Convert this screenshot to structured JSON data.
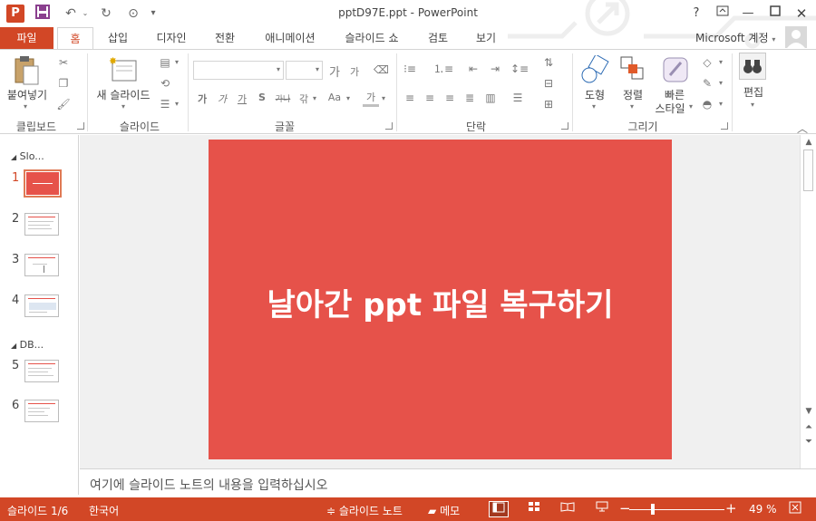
{
  "window": {
    "title": "pptD97E.ppt - PowerPoint",
    "help": "?",
    "app_icon": "P",
    "qat_save_icon": "save-icon",
    "qat_undo_icon": "undo-icon",
    "qat_redo_icon": "redo-icon",
    "qat_preview_icon": "preview-icon"
  },
  "tabs": [
    {
      "label": "파일"
    },
    {
      "label": "홈"
    },
    {
      "label": "삽입"
    },
    {
      "label": "디자인"
    },
    {
      "label": "전환"
    },
    {
      "label": "애니메이션"
    },
    {
      "label": "슬라이드 쇼"
    },
    {
      "label": "검토"
    },
    {
      "label": "보기"
    }
  ],
  "account": {
    "label": "Microsoft 계정"
  },
  "ribbon": {
    "clipboard": {
      "label": "클립보드",
      "paste": "붙여넣기"
    },
    "slides": {
      "label": "슬라이드",
      "new_slide": "새 슬라이드"
    },
    "font": {
      "label": "글꼴",
      "grow": "가",
      "shrink": "가",
      "bold": "가",
      "italic": "가",
      "underline": "가",
      "shadow": "S",
      "strike": "가나",
      "spacing": "갂",
      "case": "Aa",
      "color": "가"
    },
    "paragraph": {
      "label": "단락"
    },
    "drawing": {
      "label": "그리기",
      "shapes": "도형",
      "arrange": "정렬",
      "quick_styles_1": "빠른",
      "quick_styles_2": "스타일"
    },
    "editing": {
      "label": "편집"
    }
  },
  "thumbnails": {
    "sections": [
      "Slo...",
      "DB..."
    ],
    "slides": [
      {
        "num": "1"
      },
      {
        "num": "2"
      },
      {
        "num": "3"
      },
      {
        "num": "4"
      },
      {
        "num": "5"
      },
      {
        "num": "6"
      }
    ]
  },
  "slide": {
    "title": "날아간 ppt 파일 복구하기",
    "bg": "#e6524a"
  },
  "notes": {
    "placeholder": "여기에 슬라이드 노트의 내용을 입력하십시오"
  },
  "status": {
    "slide_counter": "슬라이드 1/6",
    "language": "한국어",
    "notes_btn": "슬라이드 노트",
    "comments_btn": "메모",
    "zoom_percent": "49 %",
    "zoom_level": 0.49
  },
  "colors": {
    "accent": "#d24726",
    "slide": "#e6524a"
  }
}
